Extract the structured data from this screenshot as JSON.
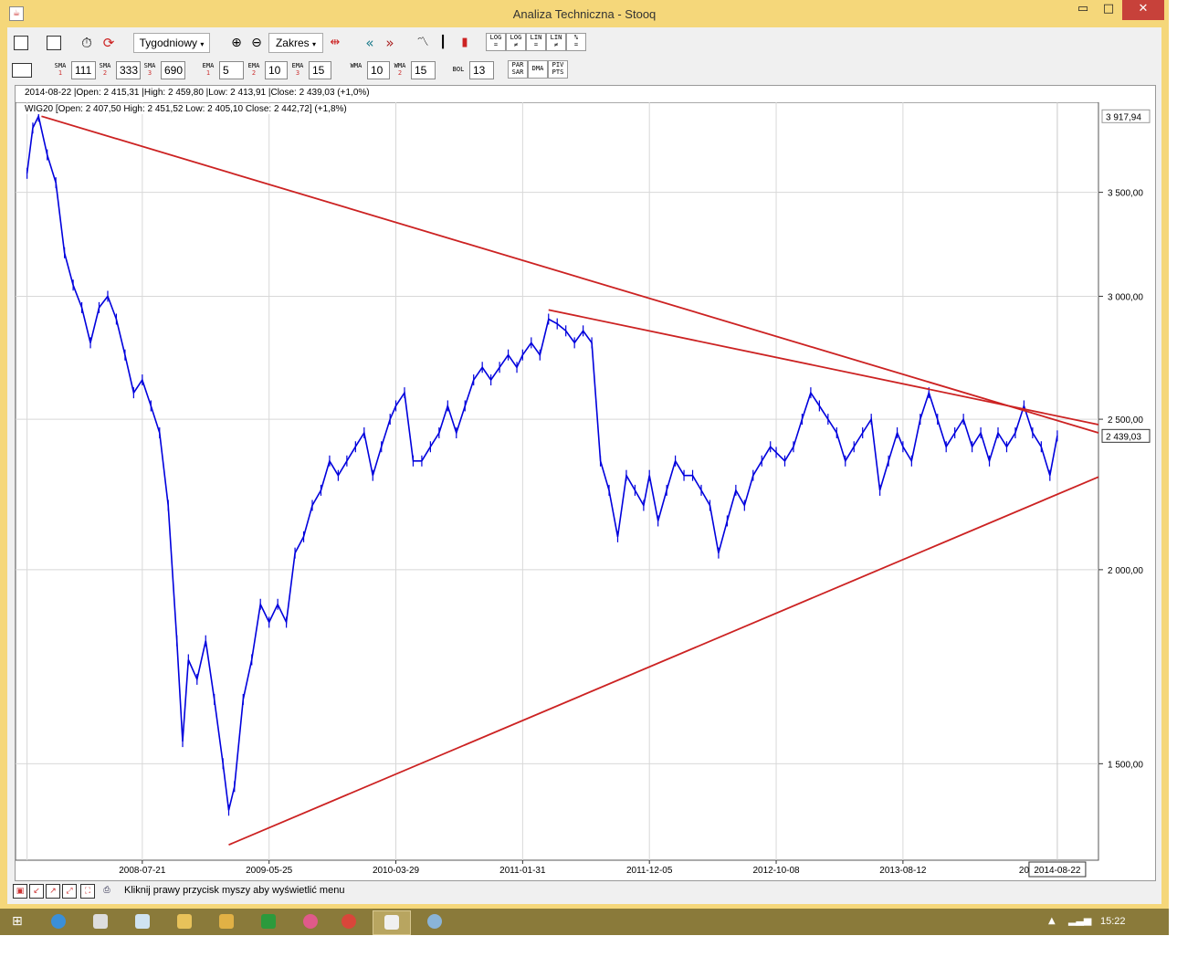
{
  "window": {
    "title": "Analiza Techniczna - Stooq",
    "minimize_glyph": "▭",
    "maximize_glyph": "□",
    "close_glyph": "✕"
  },
  "toolbar1": {
    "interval": "Tygodniowy",
    "range": "Zakres",
    "scale_buttons": [
      {
        "top": "LOG",
        "bottom": "="
      },
      {
        "top": "LOG",
        "bottom": "≠"
      },
      {
        "top": "LIN",
        "bottom": "="
      },
      {
        "top": "LIN",
        "bottom": "≠"
      },
      {
        "top": "%",
        "bottom": "="
      }
    ]
  },
  "toolbar2": {
    "sma": [
      {
        "label": "SMA",
        "index": "1",
        "value": "111"
      },
      {
        "label": "SMA",
        "index": "2",
        "value": "333"
      },
      {
        "label": "SMA",
        "index": "3",
        "value": "690"
      }
    ],
    "ema": [
      {
        "label": "EMA",
        "index": "1",
        "value": "5"
      },
      {
        "label": "EMA",
        "index": "2",
        "value": "10"
      },
      {
        "label": "EMA",
        "index": "3",
        "value": "15"
      }
    ],
    "wma": [
      {
        "label": "WMA",
        "index": "",
        "value": "10"
      },
      {
        "label": "WMA",
        "index": "2",
        "value": "15"
      }
    ],
    "bol": {
      "label": "BOL",
      "value": "13"
    },
    "extra": [
      {
        "top": "PAR",
        "bottom": "SAR"
      },
      {
        "top": "DMA",
        "bottom": ""
      },
      {
        "top": "PIV",
        "bottom": "PTS"
      }
    ]
  },
  "chart": {
    "header_line": "2014-08-22 |Open: 2 415,31 |High: 2 459,80 |Low: 2 413,91 |Close: 2 439,03 (+1,0%)",
    "instrument_line": "WIG20 [Open: 2 407,50  High: 2 451,52  Low: 2 405,10  Close: 2 442,72] (+1,8%)",
    "price_max_label": "3 917,94",
    "last_price_label": "2 439,03",
    "cursor_date_label": "2014-08-22",
    "x_partial_label": "2014"
  },
  "chart_data": {
    "type": "line",
    "instrument": "WIG20",
    "yscale": "log",
    "ylim": [
      1300,
      4000
    ],
    "grid": true,
    "y_ticks": [
      {
        "value": 1500,
        "label": "1 500,00"
      },
      {
        "value": 2000,
        "label": "2 000,00"
      },
      {
        "value": 2500,
        "label": "2 500,00"
      },
      {
        "value": 3000,
        "label": "3 000,00"
      },
      {
        "value": 3500,
        "label": "3 500,00"
      }
    ],
    "x_ticks": [
      "2008-07-21",
      "2009-05-25",
      "2010-03-29",
      "2011-01-31",
      "2011-12-05",
      "2012-10-08",
      "2013-08-12"
    ],
    "series": [
      {
        "color": "#0000dd",
        "points": [
          [
            "2007-10-15",
            3600
          ],
          [
            "2007-10-29",
            3850
          ],
          [
            "2007-11-12",
            3917.94
          ],
          [
            "2007-12-03",
            3700
          ],
          [
            "2007-12-24",
            3550
          ],
          [
            "2008-01-14",
            3200
          ],
          [
            "2008-02-04",
            3050
          ],
          [
            "2008-02-25",
            2950
          ],
          [
            "2008-03-17",
            2800
          ],
          [
            "2008-04-07",
            2950
          ],
          [
            "2008-04-28",
            3000
          ],
          [
            "2008-05-19",
            2900
          ],
          [
            "2008-06-09",
            2750
          ],
          [
            "2008-06-30",
            2600
          ],
          [
            "2008-07-21",
            2650
          ],
          [
            "2008-08-11",
            2550
          ],
          [
            "2008-09-01",
            2450
          ],
          [
            "2008-09-22",
            2200
          ],
          [
            "2008-10-13",
            1800
          ],
          [
            "2008-10-27",
            1550
          ],
          [
            "2008-11-10",
            1750
          ],
          [
            "2008-12-01",
            1700
          ],
          [
            "2008-12-22",
            1800
          ],
          [
            "2009-01-12",
            1650
          ],
          [
            "2009-02-02",
            1500
          ],
          [
            "2009-02-16",
            1400
          ],
          [
            "2009-03-02",
            1450
          ],
          [
            "2009-03-23",
            1650
          ],
          [
            "2009-04-13",
            1750
          ],
          [
            "2009-05-04",
            1900
          ],
          [
            "2009-05-25",
            1850
          ],
          [
            "2009-06-15",
            1900
          ],
          [
            "2009-07-06",
            1850
          ],
          [
            "2009-07-27",
            2050
          ],
          [
            "2009-08-17",
            2100
          ],
          [
            "2009-09-07",
            2200
          ],
          [
            "2009-09-28",
            2250
          ],
          [
            "2009-10-19",
            2350
          ],
          [
            "2009-11-09",
            2300
          ],
          [
            "2009-11-30",
            2350
          ],
          [
            "2009-12-21",
            2400
          ],
          [
            "2010-01-11",
            2450
          ],
          [
            "2010-02-01",
            2300
          ],
          [
            "2010-02-22",
            2400
          ],
          [
            "2010-03-15",
            2500
          ],
          [
            "2010-03-29",
            2550
          ],
          [
            "2010-04-19",
            2600
          ],
          [
            "2010-05-10",
            2350
          ],
          [
            "2010-05-31",
            2350
          ],
          [
            "2010-06-21",
            2400
          ],
          [
            "2010-07-12",
            2450
          ],
          [
            "2010-08-02",
            2550
          ],
          [
            "2010-08-23",
            2450
          ],
          [
            "2010-09-13",
            2550
          ],
          [
            "2010-10-04",
            2650
          ],
          [
            "2010-10-25",
            2700
          ],
          [
            "2010-11-15",
            2650
          ],
          [
            "2010-12-06",
            2700
          ],
          [
            "2010-12-27",
            2750
          ],
          [
            "2011-01-17",
            2700
          ],
          [
            "2011-01-31",
            2750
          ],
          [
            "2011-02-21",
            2800
          ],
          [
            "2011-03-14",
            2750
          ],
          [
            "2011-04-04",
            2900
          ],
          [
            "2011-04-25",
            2880
          ],
          [
            "2011-05-16",
            2850
          ],
          [
            "2011-06-06",
            2800
          ],
          [
            "2011-06-27",
            2850
          ],
          [
            "2011-07-18",
            2800
          ],
          [
            "2011-08-08",
            2350
          ],
          [
            "2011-08-29",
            2250
          ],
          [
            "2011-09-19",
            2100
          ],
          [
            "2011-10-10",
            2300
          ],
          [
            "2011-10-31",
            2250
          ],
          [
            "2011-11-21",
            2200
          ],
          [
            "2011-12-05",
            2300
          ],
          [
            "2011-12-26",
            2150
          ],
          [
            "2012-01-16",
            2250
          ],
          [
            "2012-02-06",
            2350
          ],
          [
            "2012-02-27",
            2300
          ],
          [
            "2012-03-19",
            2300
          ],
          [
            "2012-04-09",
            2250
          ],
          [
            "2012-04-30",
            2200
          ],
          [
            "2012-05-21",
            2050
          ],
          [
            "2012-06-11",
            2150
          ],
          [
            "2012-07-02",
            2250
          ],
          [
            "2012-07-23",
            2200
          ],
          [
            "2012-08-13",
            2300
          ],
          [
            "2012-09-03",
            2350
          ],
          [
            "2012-09-24",
            2400
          ],
          [
            "2012-10-08",
            2380
          ],
          [
            "2012-10-29",
            2350
          ],
          [
            "2012-11-19",
            2400
          ],
          [
            "2012-12-10",
            2500
          ],
          [
            "2012-12-31",
            2600
          ],
          [
            "2013-01-21",
            2550
          ],
          [
            "2013-02-11",
            2500
          ],
          [
            "2013-03-04",
            2450
          ],
          [
            "2013-03-25",
            2350
          ],
          [
            "2013-04-15",
            2400
          ],
          [
            "2013-05-06",
            2450
          ],
          [
            "2013-05-27",
            2500
          ],
          [
            "2013-06-17",
            2250
          ],
          [
            "2013-07-08",
            2350
          ],
          [
            "2013-07-29",
            2450
          ],
          [
            "2013-08-12",
            2400
          ],
          [
            "2013-09-02",
            2350
          ],
          [
            "2013-09-23",
            2500
          ],
          [
            "2013-10-14",
            2600
          ],
          [
            "2013-11-04",
            2500
          ],
          [
            "2013-11-25",
            2400
          ],
          [
            "2013-12-16",
            2450
          ],
          [
            "2014-01-06",
            2500
          ],
          [
            "2014-01-27",
            2400
          ],
          [
            "2014-02-17",
            2450
          ],
          [
            "2014-03-10",
            2350
          ],
          [
            "2014-03-31",
            2450
          ],
          [
            "2014-04-21",
            2400
          ],
          [
            "2014-05-12",
            2450
          ],
          [
            "2014-06-02",
            2550
          ],
          [
            "2014-06-23",
            2450
          ],
          [
            "2014-07-14",
            2400
          ],
          [
            "2014-08-04",
            2300
          ],
          [
            "2014-08-22",
            2439.03
          ]
        ]
      },
      {
        "color": "#cc2222",
        "points": [
          [
            "2007-11-19",
            3917.94
          ],
          [
            "2014-11-30",
            2450
          ]
        ]
      },
      {
        "color": "#cc2222",
        "points": [
          [
            "2011-04-04",
            2940
          ],
          [
            "2014-11-30",
            2480
          ]
        ]
      },
      {
        "color": "#cc2222",
        "points": [
          [
            "2009-02-16",
            1330
          ],
          [
            "2014-11-30",
            2295
          ]
        ]
      }
    ]
  },
  "statusbar": {
    "text": "Kliknij prawy przycisk myszy aby wyświetlić menu"
  },
  "taskbar": {
    "time": "15:22"
  }
}
